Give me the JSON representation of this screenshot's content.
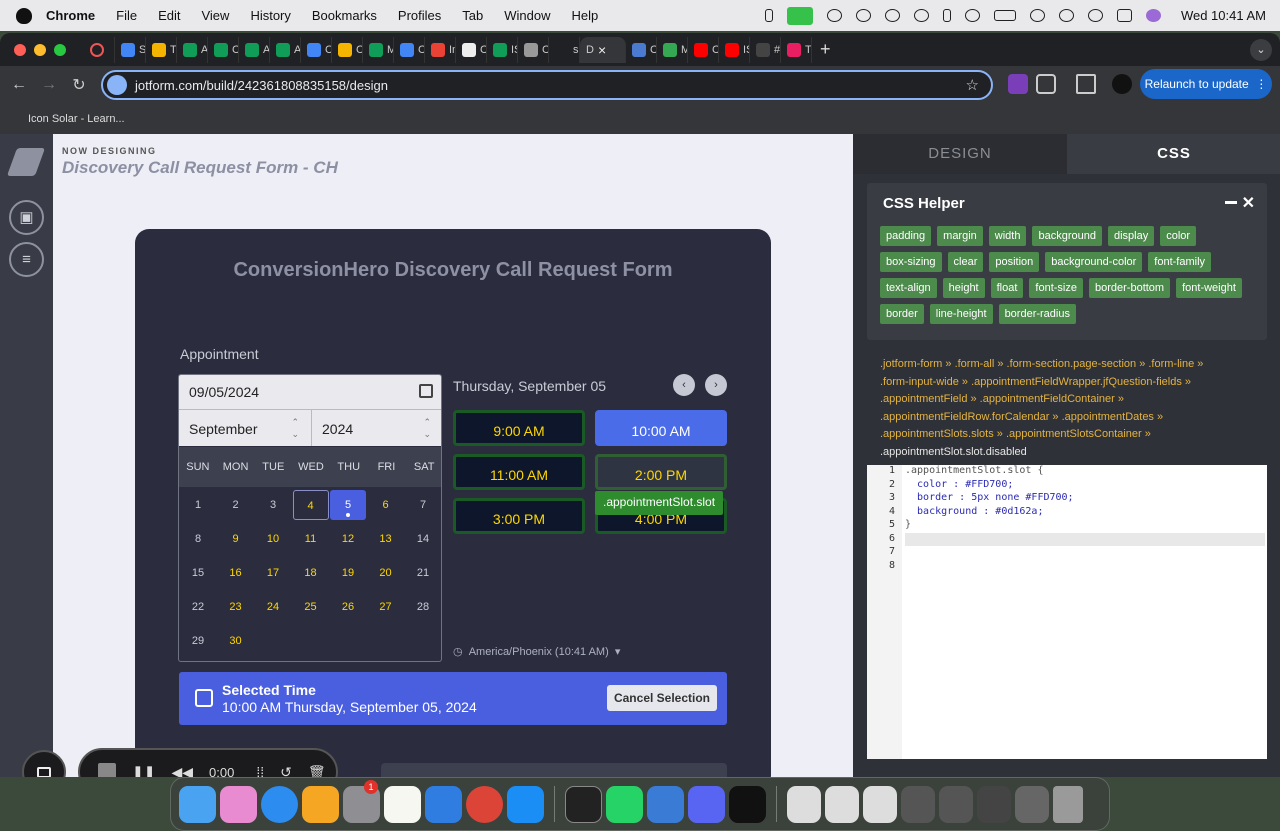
{
  "menubar": {
    "app": "Chrome",
    "items": [
      "File",
      "Edit",
      "View",
      "History",
      "Bookmarks",
      "Profiles",
      "Tab",
      "Window",
      "Help"
    ],
    "clock": "Wed 10:41 AM"
  },
  "browser": {
    "tabs": [
      {
        "label": "St",
        "color": "#4285f4"
      },
      {
        "label": "Tr",
        "color": "#f4b400"
      },
      {
        "label": "Ac",
        "color": "#0f9d58"
      },
      {
        "label": "Cl",
        "color": "#0f9d58"
      },
      {
        "label": "A",
        "color": "#0f9d58"
      },
      {
        "label": "A",
        "color": "#0f9d58"
      },
      {
        "label": "C",
        "color": "#4285f4"
      },
      {
        "label": "C",
        "color": "#f4b400"
      },
      {
        "label": "M",
        "color": "#0f9d58"
      },
      {
        "label": "Cl",
        "color": "#4285f4"
      },
      {
        "label": "In",
        "color": "#ea4335"
      },
      {
        "label": "C",
        "color": "#eeeeee"
      },
      {
        "label": "IS",
        "color": "#0f9d58"
      },
      {
        "label": "C",
        "color": "#999999"
      },
      {
        "label": "sc",
        "color": "#202124"
      }
    ],
    "active_tab": "D",
    "tabs_after": [
      {
        "label": "Cl",
        "color": "#4a7bd0"
      },
      {
        "label": "M",
        "color": "#34a853"
      },
      {
        "label": "Cl",
        "color": "#ff0000"
      },
      {
        "label": "IS",
        "color": "#ff0000"
      },
      {
        "label": "#",
        "color": "#444444"
      },
      {
        "label": "Ti",
        "color": "#e91e63"
      }
    ],
    "url": "jotform.com/build/242361808835158/design",
    "relaunch": "Relaunch to update",
    "bookmark": "Icon Solar - Learn..."
  },
  "builder": {
    "now_designing": "NOW DESIGNING",
    "form_name": "Discovery Call Request Form - CH"
  },
  "form": {
    "heading": "ConversionHero Discovery Call Request Form",
    "appointment_label": "Appointment",
    "date_value": "09/05/2024",
    "month": "September",
    "year": "2024",
    "weekdays": [
      "SUN",
      "MON",
      "TUE",
      "WED",
      "THU",
      "FRI",
      "SAT"
    ],
    "days": [
      {
        "d": "1",
        "s": "past"
      },
      {
        "d": "2",
        "s": "past"
      },
      {
        "d": "3",
        "s": "past"
      },
      {
        "d": "4",
        "s": "today"
      },
      {
        "d": "5",
        "s": "sel"
      },
      {
        "d": "6",
        "s": "avail"
      },
      {
        "d": "7",
        "s": "past"
      },
      {
        "d": "8",
        "s": "past"
      },
      {
        "d": "9",
        "s": "avail"
      },
      {
        "d": "10",
        "s": "avail"
      },
      {
        "d": "11",
        "s": "avail"
      },
      {
        "d": "12",
        "s": "avail"
      },
      {
        "d": "13",
        "s": "avail"
      },
      {
        "d": "14",
        "s": "past"
      },
      {
        "d": "15",
        "s": "past"
      },
      {
        "d": "16",
        "s": "avail"
      },
      {
        "d": "17",
        "s": "avail"
      },
      {
        "d": "18",
        "s": "avail"
      },
      {
        "d": "19",
        "s": "avail"
      },
      {
        "d": "20",
        "s": "avail"
      },
      {
        "d": "21",
        "s": "past"
      },
      {
        "d": "22",
        "s": "past"
      },
      {
        "d": "23",
        "s": "avail"
      },
      {
        "d": "24",
        "s": "avail"
      },
      {
        "d": "25",
        "s": "avail"
      },
      {
        "d": "26",
        "s": "avail"
      },
      {
        "d": "27",
        "s": "avail"
      },
      {
        "d": "28",
        "s": "past"
      },
      {
        "d": "29",
        "s": "past"
      },
      {
        "d": "30",
        "s": "avail"
      }
    ],
    "slot_date": "Thursday, September 05",
    "slots": [
      {
        "time": "9:00 AM",
        "style": "gold"
      },
      {
        "time": "10:00 AM",
        "style": "selected"
      },
      {
        "time": "11:00 AM",
        "style": "gold"
      },
      {
        "time": "2:00 PM",
        "style": "hover"
      },
      {
        "time": "3:00 PM",
        "style": "gold"
      },
      {
        "time": "4:00 PM",
        "style": "gold"
      }
    ],
    "tooltip": ".appointmentSlot.slot",
    "timezone": "America/Phoenix (10:41 AM)",
    "selected_title": "Selected Time",
    "selected_value": "10:00 AM Thursday, September 05, 2024",
    "cancel": "Cancel Selection"
  },
  "recorder": {
    "timer": "0:00"
  },
  "panel": {
    "tab_design": "DESIGN",
    "tab_css": "CSS",
    "helper_title": "CSS Helper",
    "chips": [
      "padding",
      "margin",
      "width",
      "background",
      "display",
      "color",
      "box-sizing",
      "clear",
      "position",
      "background-color",
      "font-family",
      "text-align",
      "height",
      "float",
      "font-size",
      "border-bottom",
      "font-weight",
      "border",
      "line-height",
      "border-radius"
    ],
    "breadcrumb": [
      ".jotform-form » .form-all » .form-section.page-section » .form-line »",
      ".form-input-wide » .appointmentFieldWrapper.jfQuestion-fields »",
      ".appointmentField » .appointmentFieldContainer »",
      ".appointmentFieldRow.forCalendar » .appointmentDates »",
      ".appointmentSlots.slots » .appointmentSlotsContainer »"
    ],
    "breadcrumb_last": ".appointmentSlot.slot.disabled",
    "line_numbers": [
      "1",
      "2",
      "3",
      "4",
      "5",
      "6",
      "7",
      "8"
    ],
    "code": [
      ".appointmentSlot.slot {",
      "  color : #FFD700;",
      "  border : 5px none #FFD700;",
      "  background : #0d162a;",
      "}",
      "",
      "",
      ""
    ]
  }
}
